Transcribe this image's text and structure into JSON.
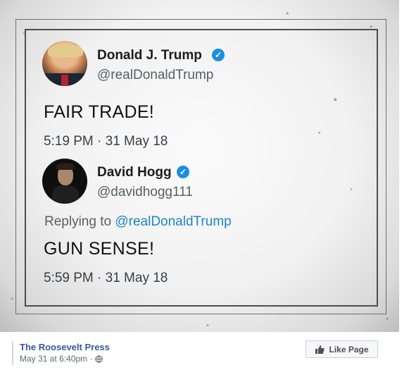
{
  "post": {
    "tweet1": {
      "name": "Donald J. Trump",
      "handle": "@realDonaldTrump",
      "text": "FAIR TRADE!",
      "time": "5:19 PM · 31 May 18",
      "verified_icon": "verified-check-icon",
      "badge_color": "#1d8fdd"
    },
    "tweet2": {
      "name": "David Hogg",
      "handle": "@davidhogg111",
      "replying_prefix": "Replying to ",
      "replying_mention": "@realDonaldTrump",
      "text": "GUN SENSE!",
      "time": "5:59 PM · 31 May 18",
      "verified_icon": "verified-check-icon",
      "mention_color": "#1b84c8"
    }
  },
  "footer": {
    "page_name": "The Roosevelt Press",
    "timestamp": "May 31 at 6:40pm ·",
    "privacy_icon": "globe-icon",
    "like_button_label": "Like Page",
    "like_icon": "thumbs-up-icon",
    "link_color": "#365899"
  }
}
